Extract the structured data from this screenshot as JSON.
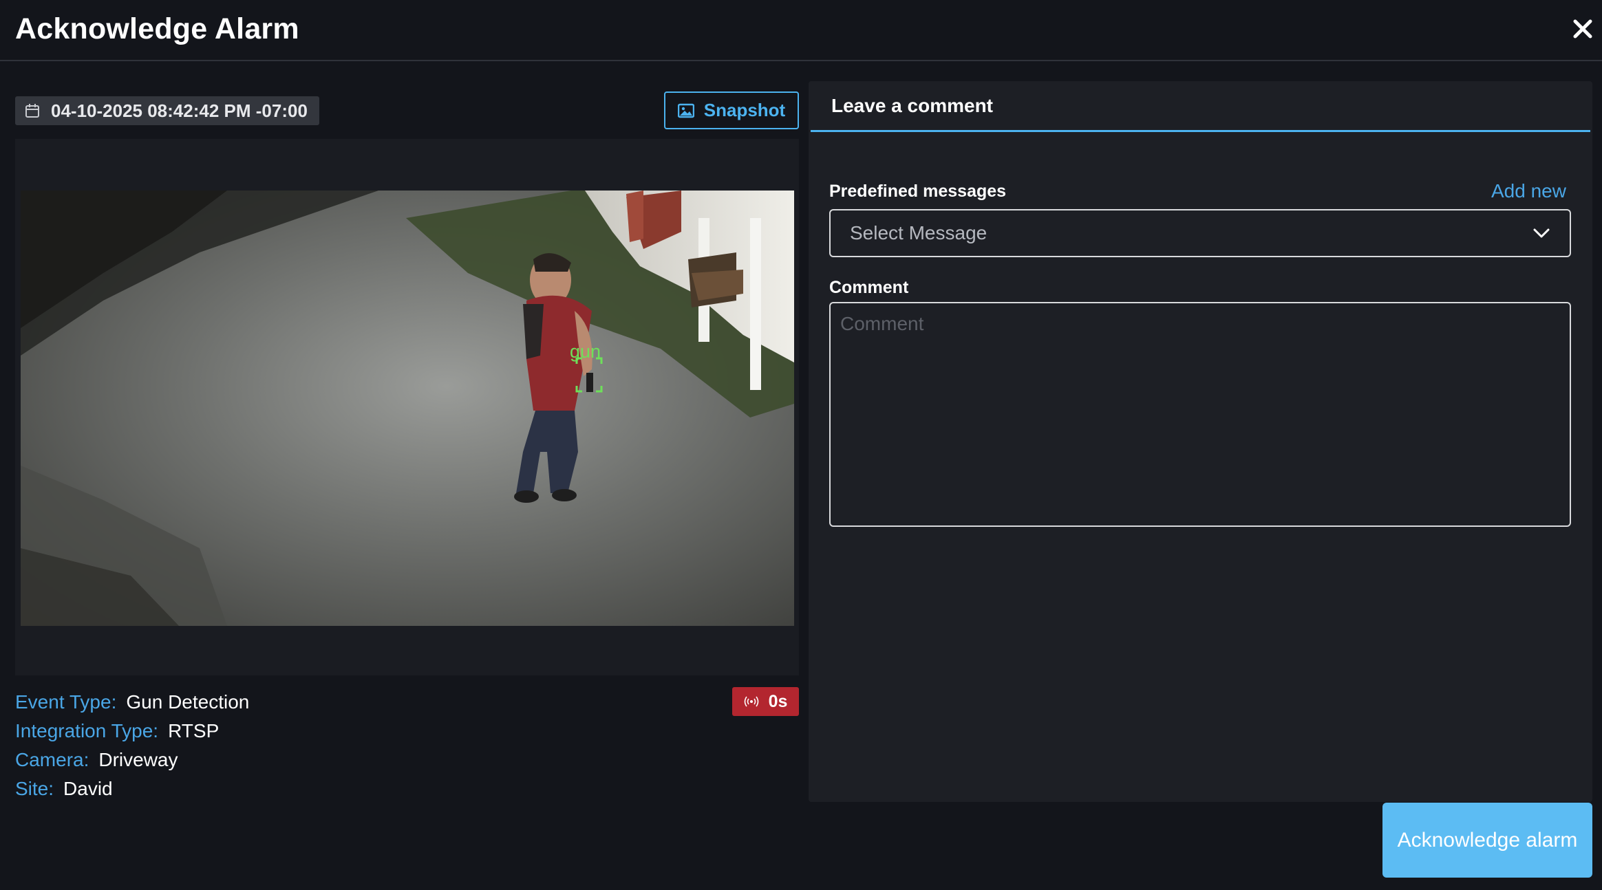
{
  "dialog": {
    "title": "Acknowledge Alarm",
    "close_icon": "close-icon"
  },
  "event": {
    "timestamp": "04-10-2025 08:42:42 PM -07:00",
    "calendar_icon": "calendar-icon",
    "snapshot_label": "Snapshot",
    "snapshot_icon": "image-icon",
    "detection_label": "gun",
    "detection_color": "#6ee05a",
    "duration": "0s",
    "duration_icon": "broadcast-icon",
    "duration_badge_color": "#b3262f"
  },
  "info": [
    {
      "label": "Event Type:",
      "value": "Gun Detection"
    },
    {
      "label": "Integration Type:",
      "value": "RTSP"
    },
    {
      "label": "Camera:",
      "value": "Driveway"
    },
    {
      "label": "Site:",
      "value": "David"
    }
  ],
  "comment_panel": {
    "tab_label": "Leave a comment",
    "predefined_label": "Predefined messages",
    "add_new_label": "Add new",
    "select_value": "Select Message",
    "select_icon": "chevron-down-icon",
    "comment_label": "Comment",
    "comment_placeholder": "Comment"
  },
  "actions": {
    "acknowledge_label": "Acknowledge alarm"
  },
  "colors": {
    "accent": "#4cb3f0",
    "info_label": "#4aa6e6",
    "background": "#13151b",
    "panel": "#1d1f25",
    "primary_button": "#5cbcf3"
  }
}
